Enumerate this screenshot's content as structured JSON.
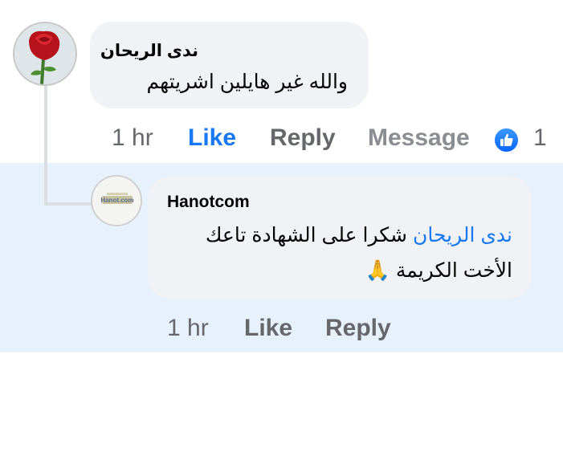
{
  "comment": {
    "author": "ندى الريحان",
    "text": "والله غير هايلين  اشريتهم",
    "time": "1 hr",
    "like_label": "Like",
    "reply_label": "Reply",
    "message_label": "Message",
    "reaction_count": "1",
    "reaction_icon": "thumbs-up-icon"
  },
  "reply": {
    "author": "Hanotcom",
    "mention": "ندى الريحان",
    "text_line1": "شكرا على الشهادة تاعك",
    "text_line2": "الأخت الكريمة 🙏",
    "time": "1 hr",
    "like_label": "Like",
    "reply_label": "Reply",
    "avatar_logo_text": "Hanot.com"
  },
  "colors": {
    "accent": "#1877f2",
    "bubble": "#f0f2f5",
    "reply_highlight": "#e7f1fc",
    "secondary_text": "#65676b"
  }
}
